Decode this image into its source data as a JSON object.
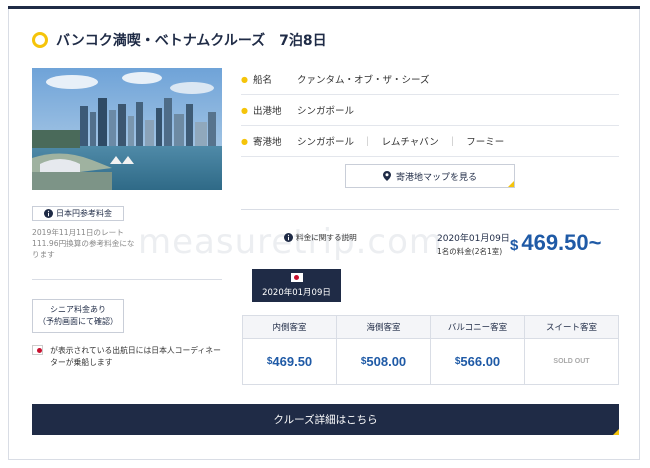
{
  "title": "バンコク満喫・ベトナムクルーズ　7泊8日",
  "info": {
    "ship_label": "船名",
    "ship_value": "クァンタム・オブ・ザ・シーズ",
    "departure_label": "出港地",
    "departure_value": "シンガポール",
    "ports_label": "寄港地",
    "ports": [
      "シンガポール",
      "レムチャバン",
      "フーミー"
    ],
    "port_separator": "｜"
  },
  "map_button_label": "寄港地マップを見る",
  "jpy_badge_label": "日本円参考料金",
  "rate_note": "2019年11月11日のレート111.96円換算の参考料金になります",
  "fee_link_label": "料金に関する説明",
  "selected_date": "2020年01月09日",
  "per_person_note": "1名の料金(2名1室)",
  "price": {
    "currency": "$",
    "amount": "469.50~"
  },
  "date_tab_label": "2020年01月09日",
  "senior": {
    "line1": "シニア料金あり",
    "line2": "（予約画面にて確認）"
  },
  "coordinator_note": "が表示されている出航日には日本人コーディネーターが乗船します",
  "table": {
    "headers": [
      "内側客室",
      "海側客室",
      "バルコニー客室",
      "スイート客室"
    ],
    "prices": [
      {
        "currency": "$",
        "amount": "469.50"
      },
      {
        "currency": "$",
        "amount": "508.00"
      },
      {
        "currency": "$",
        "amount": "566.00"
      }
    ],
    "soldout": "SOLD OUT"
  },
  "cta_label": "クルーズ詳細はこちら",
  "watermark": "measuretrip.com",
  "colors": {
    "navy": "#1f2b46",
    "accent_yellow": "#f5c40a",
    "price_blue": "#1f5aa6"
  }
}
